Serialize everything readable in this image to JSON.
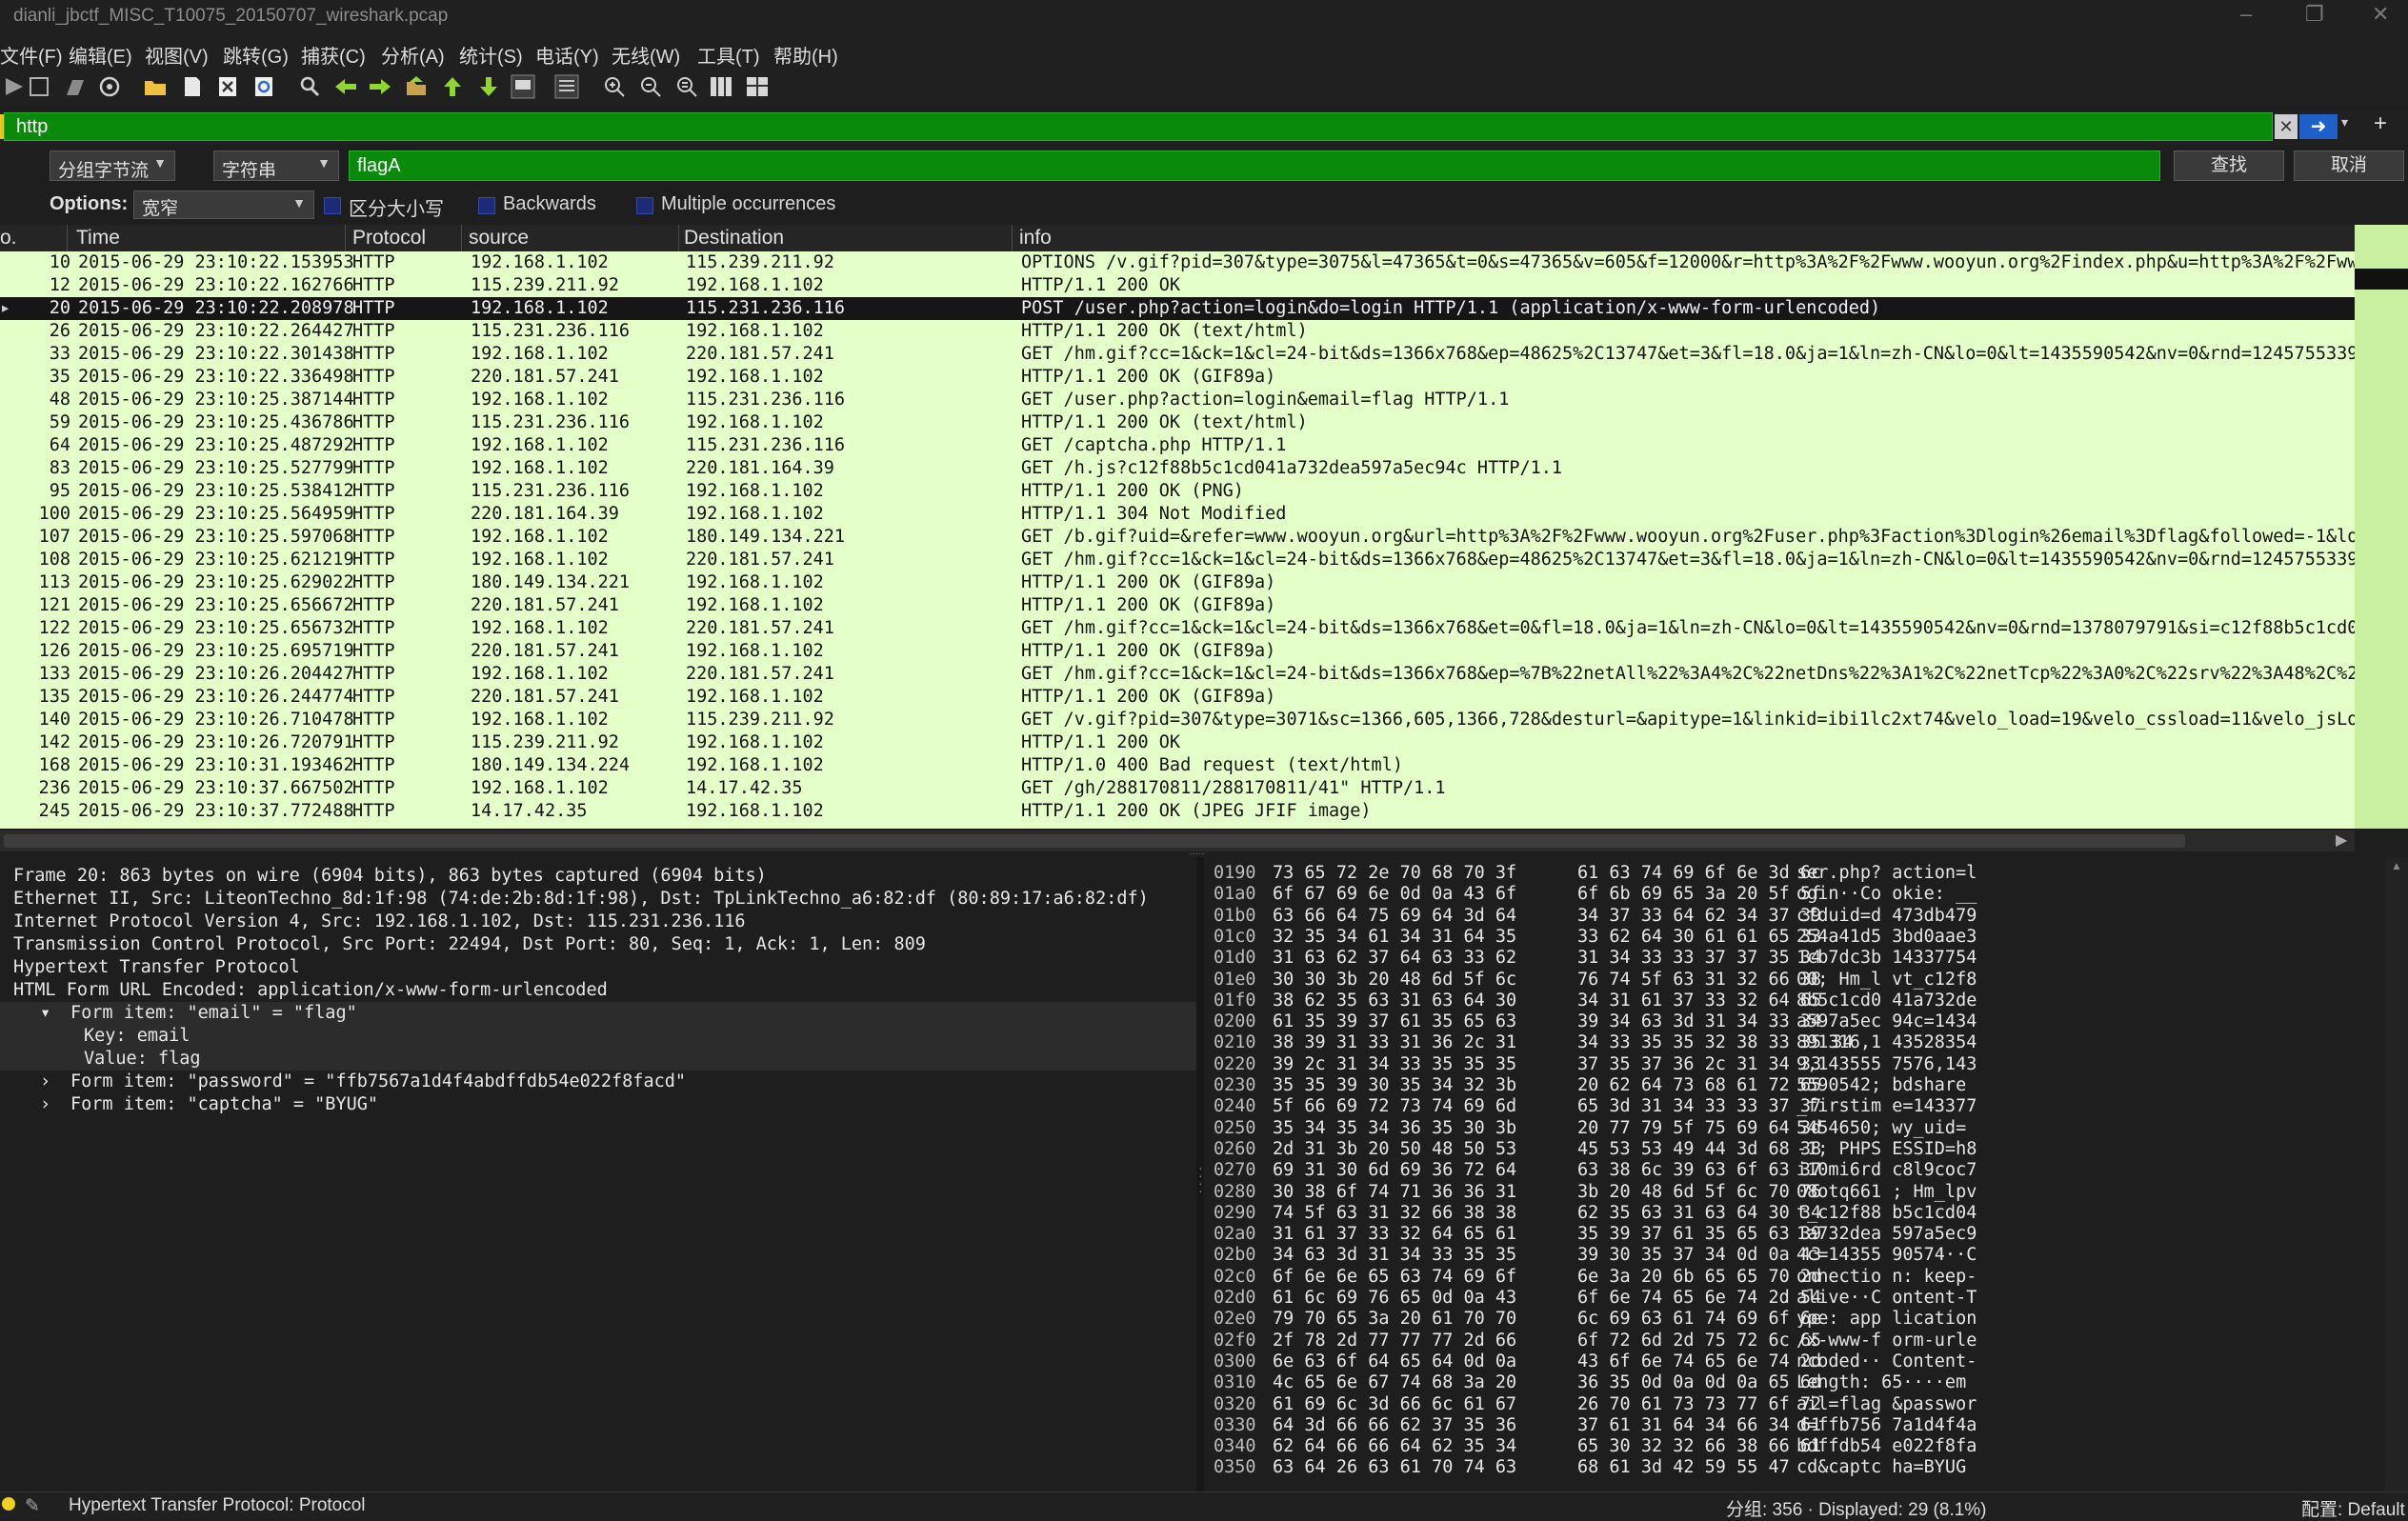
{
  "window": {
    "title": "dianli_jbctf_MISC_T10075_20150707_wireshark.pcap"
  },
  "menu": [
    "文件(F)",
    "编辑(E)",
    "视图(V)",
    "跳转(G)",
    "捕获(C)",
    "分析(A)",
    "统计(S)",
    "电话(Y)",
    "无线(W)",
    "工具(T)",
    "帮助(H)"
  ],
  "toolbar": {
    "icons": [
      "start-capture-icon",
      "stop-capture-icon",
      "restart-capture-icon",
      "capture-options-icon",
      "open-file-icon",
      "save-file-icon",
      "close-file-icon",
      "reload-file-icon",
      "find-packet-icon",
      "go-back-icon",
      "go-forward-icon",
      "go-to-packet-icon",
      "first-packet-icon",
      "last-packet-icon",
      "auto-scroll-icon",
      "colorize-icon",
      "zoom-in-icon",
      "zoom-out-icon",
      "normal-size-icon",
      "resize-columns-icon",
      "layout-icon"
    ]
  },
  "filter": {
    "value": "http"
  },
  "find": {
    "search_in": "分组字节流",
    "search_type": "字符串",
    "value": "flagA",
    "find_label": "查找",
    "cancel_label": "取消"
  },
  "options": {
    "label": "Options:",
    "width_value": "宽窄",
    "case_label": "区分大小写",
    "backwards_label": "Backwards",
    "multiple_label": "Multiple occurrences"
  },
  "columns": {
    "no": "o.",
    "time": "Time",
    "protocol": "Protocol",
    "source": "source",
    "destination": "Destination",
    "info": "info"
  },
  "packets": [
    {
      "no": "10",
      "time": "2015-06-29 23:10:22.153953",
      "proto": "HTTP",
      "src": "192.168.1.102",
      "dst": "115.239.211.92",
      "info": "OPTIONS /v.gif?pid=307&type=3075&l=47365&t=0&s=47365&v=605&f=12000&r=http%3A%2F%2Fwww.wooyun.org%2Findex.php&u=http%3A%2F%2Fwww.woo"
    },
    {
      "no": "12",
      "time": "2015-06-29 23:10:22.162766",
      "proto": "HTTP",
      "src": "115.239.211.92",
      "dst": "192.168.1.102",
      "info": "HTTP/1.1 200 OK"
    },
    {
      "no": "20",
      "time": "2015-06-29 23:10:22.208978",
      "proto": "HTTP",
      "src": "192.168.1.102",
      "dst": "115.231.236.116",
      "info": "POST /user.php?action=login&do=login HTTP/1.1  (application/x-www-form-urlencoded)",
      "selected": true
    },
    {
      "no": "26",
      "time": "2015-06-29 23:10:22.264427",
      "proto": "HTTP",
      "src": "115.231.236.116",
      "dst": "192.168.1.102",
      "info": "HTTP/1.1 200 OK  (text/html)"
    },
    {
      "no": "33",
      "time": "2015-06-29 23:10:22.301438",
      "proto": "HTTP",
      "src": "192.168.1.102",
      "dst": "220.181.57.241",
      "info": "GET /hm.gif?cc=1&ck=1&cl=24-bit&ds=1366x768&ep=48625%2C13747&et=3&fl=18.0&ja=1&ln=zh-CN&lo=0&lt=1435590542&nv=0&rnd=1245755339&si=c"
    },
    {
      "no": "35",
      "time": "2015-06-29 23:10:22.336498",
      "proto": "HTTP",
      "src": "220.181.57.241",
      "dst": "192.168.1.102",
      "info": "HTTP/1.1 200 OK  (GIF89a)"
    },
    {
      "no": "48",
      "time": "2015-06-29 23:10:25.387144",
      "proto": "HTTP",
      "src": "192.168.1.102",
      "dst": "115.231.236.116",
      "info": "GET /user.php?action=login&email=flag HTTP/1.1"
    },
    {
      "no": "59",
      "time": "2015-06-29 23:10:25.436786",
      "proto": "HTTP",
      "src": "115.231.236.116",
      "dst": "192.168.1.102",
      "info": "HTTP/1.1 200 OK  (text/html)"
    },
    {
      "no": "64",
      "time": "2015-06-29 23:10:25.487292",
      "proto": "HTTP",
      "src": "192.168.1.102",
      "dst": "115.231.236.116",
      "info": "GET /captcha.php HTTP/1.1"
    },
    {
      "no": "83",
      "time": "2015-06-29 23:10:25.527799",
      "proto": "HTTP",
      "src": "192.168.1.102",
      "dst": "220.181.164.39",
      "info": "GET /h.js?c12f88b5c1cd041a732dea597a5ec94c HTTP/1.1"
    },
    {
      "no": "95",
      "time": "2015-06-29 23:10:25.538412",
      "proto": "HTTP",
      "src": "115.231.236.116",
      "dst": "192.168.1.102",
      "info": "HTTP/1.1 200 OK  (PNG)"
    },
    {
      "no": "100",
      "time": "2015-06-29 23:10:25.564959",
      "proto": "HTTP",
      "src": "220.181.164.39",
      "dst": "192.168.1.102",
      "info": "HTTP/1.1 304 Not Modified"
    },
    {
      "no": "107",
      "time": "2015-06-29 23:10:25.597068",
      "proto": "HTTP",
      "src": "192.168.1.102",
      "dst": "180.149.134.221",
      "info": "GET /b.gif?uid=&refer=www.wooyun.org&url=http%3A%2F%2Fwww.wooyun.org%2Fuser.php%3Faction%3Dlogin%26email%3Dflag&followed=-1&login=0"
    },
    {
      "no": "108",
      "time": "2015-06-29 23:10:25.621219",
      "proto": "HTTP",
      "src": "192.168.1.102",
      "dst": "220.181.57.241",
      "info": "GET /hm.gif?cc=1&ck=1&cl=24-bit&ds=1366x768&ep=48625%2C13747&et=3&fl=18.0&ja=1&ln=zh-CN&lo=0&lt=1435590542&nv=0&rnd=1245755339&si=c"
    },
    {
      "no": "113",
      "time": "2015-06-29 23:10:25.629022",
      "proto": "HTTP",
      "src": "180.149.134.221",
      "dst": "192.168.1.102",
      "info": "HTTP/1.1 200 OK  (GIF89a)"
    },
    {
      "no": "121",
      "time": "2015-06-29 23:10:25.656672",
      "proto": "HTTP",
      "src": "220.181.57.241",
      "dst": "192.168.1.102",
      "info": "HTTP/1.1 200 OK  (GIF89a)"
    },
    {
      "no": "122",
      "time": "2015-06-29 23:10:25.656732",
      "proto": "HTTP",
      "src": "192.168.1.102",
      "dst": "220.181.57.241",
      "info": "GET /hm.gif?cc=1&ck=1&cl=24-bit&ds=1366x768&et=0&fl=18.0&ja=1&ln=zh-CN&lo=0&lt=1435590542&nv=0&rnd=1378079791&si=c12f88b5c1cd041a73"
    },
    {
      "no": "126",
      "time": "2015-06-29 23:10:25.695719",
      "proto": "HTTP",
      "src": "220.181.57.241",
      "dst": "192.168.1.102",
      "info": "HTTP/1.1 200 OK  (GIF89a)"
    },
    {
      "no": "133",
      "time": "2015-06-29 23:10:26.204427",
      "proto": "HTTP",
      "src": "192.168.1.102",
      "dst": "220.181.57.241",
      "info": "GET /hm.gif?cc=1&ck=1&cl=24-bit&ds=1366x768&ep=%7B%22netAll%22%3A4%2C%22netDns%22%3A1%2C%22netTcp%22%3A0%2C%22srv%22%3A48%2C%22dom%"
    },
    {
      "no": "135",
      "time": "2015-06-29 23:10:26.244774",
      "proto": "HTTP",
      "src": "220.181.57.241",
      "dst": "192.168.1.102",
      "info": "HTTP/1.1 200 OK  (GIF89a)"
    },
    {
      "no": "140",
      "time": "2015-06-29 23:10:26.710478",
      "proto": "HTTP",
      "src": "192.168.1.102",
      "dst": "115.239.211.92",
      "info": "GET /v.gif?pid=307&type=3071&sc=1366,605,1366,728&desturl=&apitype=1&linkid=ibi1lc2xt74&velo_load=19&velo_cssload=11&velo_jsLoad=13"
    },
    {
      "no": "142",
      "time": "2015-06-29 23:10:26.720791",
      "proto": "HTTP",
      "src": "115.239.211.92",
      "dst": "192.168.1.102",
      "info": "HTTP/1.1 200 OK"
    },
    {
      "no": "168",
      "time": "2015-06-29 23:10:31.193462",
      "proto": "HTTP",
      "src": "180.149.134.224",
      "dst": "192.168.1.102",
      "info": "HTTP/1.0 400 Bad request  (text/html)"
    },
    {
      "no": "236",
      "time": "2015-06-29 23:10:37.667502",
      "proto": "HTTP",
      "src": "192.168.1.102",
      "dst": "14.17.42.35",
      "info": "GET /gh/288170811/288170811/41\" HTTP/1.1"
    },
    {
      "no": "245",
      "time": "2015-06-29 23:10:37.772488",
      "proto": "HTTP",
      "src": "14.17.42.35",
      "dst": "192.168.1.102",
      "info": "HTTP/1.1 200 OK  (JPEG JFIF image)"
    }
  ],
  "details": [
    {
      "text": "Frame 20: 863 bytes on wire (6904 bits), 863 bytes captured (6904 bits)",
      "indent": 0,
      "toggle": ""
    },
    {
      "text": "Ethernet II, Src: LiteonTechno_8d:1f:98 (74:de:2b:8d:1f:98), Dst: TpLinkTechno_a6:82:df (80:89:17:a6:82:df)",
      "indent": 0,
      "toggle": ""
    },
    {
      "text": "Internet Protocol Version 4, Src: 192.168.1.102, Dst: 115.231.236.116",
      "indent": 0,
      "toggle": ""
    },
    {
      "text": "Transmission Control Protocol, Src Port: 22494, Dst Port: 80, Seq: 1, Ack: 1, Len: 809",
      "indent": 0,
      "toggle": ""
    },
    {
      "text": "Hypertext Transfer Protocol",
      "indent": 0,
      "toggle": ""
    },
    {
      "text": "HTML Form URL Encoded: application/x-www-form-urlencoded",
      "indent": 0,
      "toggle": ""
    },
    {
      "text": "Form item: \"email\" = \"flag\"",
      "indent": 1,
      "toggle": "▾",
      "hl": true
    },
    {
      "text": "Key: email",
      "indent": 2,
      "toggle": "",
      "hl": true
    },
    {
      "text": "Value: flag",
      "indent": 2,
      "toggle": "",
      "hl": true
    },
    {
      "text": "Form item: \"password\" = \"ffb7567a1d4f4abdffdb54e022f8facd\"",
      "indent": 1,
      "toggle": "›"
    },
    {
      "text": "Form item: \"captcha\" = \"BYUG\"",
      "indent": 1,
      "toggle": "›"
    }
  ],
  "hex": [
    {
      "off": "0190",
      "b1": "73 65 72 2e 70 68 70 3f",
      "b2": "61 63 74 69 6f 6e 3d 6c",
      "a": "ser.php? action=l"
    },
    {
      "off": "01a0",
      "b1": "6f 67 69 6e 0d 0a 43 6f",
      "b2": "6f 6b 69 65 3a 20 5f 5f",
      "a": "ogin··Co okie: __"
    },
    {
      "off": "01b0",
      "b1": "63 66 64 75 69 64 3d 64",
      "b2": "34 37 33 64 62 34 37 39",
      "a": "cfduid=d 473db479"
    },
    {
      "off": "01c0",
      "b1": "32 35 34 61 34 31 64 35",
      "b2": "33 62 64 30 61 61 65 33",
      "a": "254a41d5 3bd0aae3"
    },
    {
      "off": "01d0",
      "b1": "31 63 62 37 64 63 33 62",
      "b2": "31 34 33 33 37 37 35 34",
      "a": "1cb7dc3b 14337754"
    },
    {
      "off": "01e0",
      "b1": "30 30 3b 20 48 6d 5f 6c",
      "b2": "76 74 5f 63 31 32 66 38",
      "a": "00; Hm_l vt_c12f8"
    },
    {
      "off": "01f0",
      "b1": "38 62 35 63 31 63 64 30",
      "b2": "34 31 61 37 33 32 64 65",
      "a": "8b5c1cd0 41a732de"
    },
    {
      "off": "0200",
      "b1": "61 35 39 37 61 35 65 63",
      "b2": "39 34 63 3d 31 34 33 34",
      "a": "a597a5ec 94c=1434"
    },
    {
      "off": "0210",
      "b1": "38 39 31 33 31 36 2c 31",
      "b2": "34 33 35 35 32 38 33 35 34",
      "a": "891316,1 43528354"
    },
    {
      "off": "0220",
      "b1": "39 2c 31 34 33 35 35 35",
      "b2": "37 35 37 36 2c 31 34 33",
      "a": "9,143555 7576,143"
    },
    {
      "off": "0230",
      "b1": "35 35 39 30 35 34 32 3b",
      "b2": "20 62 64 73 68 61 72 65",
      "a": "5590542;  bdshare"
    },
    {
      "off": "0240",
      "b1": "5f 66 69 72 73 74 69 6d",
      "b2": "65 3d 31 34 33 33 37 37",
      "a": "_firstim e=143377"
    },
    {
      "off": "0250",
      "b1": "35 34 35 34 36 35 30 3b",
      "b2": "20 77 79 5f 75 69 64 3d",
      "a": "5454650;  wy_uid="
    },
    {
      "off": "0260",
      "b1": "2d 31 3b 20 50 48 50 53",
      "b2": "45 53 53 49 44 3d 68 38",
      "a": "-1; PHPS ESSID=h8"
    },
    {
      "off": "0270",
      "b1": "69 31 30 6d 69 36 72 64",
      "b2": "63 38 6c 39 63 6f 63 37",
      "a": "i10mi6rd c8l9coc7"
    },
    {
      "off": "0280",
      "b1": "30 38 6f 74 71 36 36 31",
      "b2": "3b 20 48 6d 5f 6c 70 76",
      "a": "08otq661 ; Hm_lpv"
    },
    {
      "off": "0290",
      "b1": "74 5f 63 31 32 66 38 38",
      "b2": "62 35 63 31 63 64 30 34",
      "a": "t_c12f88 b5c1cd04"
    },
    {
      "off": "02a0",
      "b1": "31 61 37 33 32 64 65 61",
      "b2": "35 39 37 61 35 65 63 39",
      "a": "1a732dea 597a5ec9"
    },
    {
      "off": "02b0",
      "b1": "34 63 3d 31 34 33 35 35",
      "b2": "39 30 35 37 34 0d 0a 43",
      "a": "4c=14355 90574··C"
    },
    {
      "off": "02c0",
      "b1": "6f 6e 6e 65 63 74 69 6f",
      "b2": "6e 3a 20 6b 65 65 70 2d",
      "a": "onnectio n: keep-"
    },
    {
      "off": "02d0",
      "b1": "61 6c 69 76 65 0d 0a 43",
      "b2": "6f 6e 74 65 6e 74 2d 54",
      "a": "alive··C ontent-T"
    },
    {
      "off": "02e0",
      "b1": "79 70 65 3a 20 61 70 70",
      "b2": "6c 69 63 61 74 69 6f 6e",
      "a": "ype: app lication"
    },
    {
      "off": "02f0",
      "b1": "2f 78 2d 77 77 77 2d 66",
      "b2": "6f 72 6d 2d 75 72 6c 65",
      "a": "/x-www-f orm-urle"
    },
    {
      "off": "0300",
      "b1": "6e 63 6f 64 65 64 0d 0a",
      "b2": "43 6f 6e 74 65 6e 74 2d",
      "a": "ncoded·· Content-"
    },
    {
      "off": "0310",
      "b1": "4c 65 6e 67 74 68 3a 20",
      "b2": "36 35 0d 0a 0d 0a 65 6d",
      "a": "Length:  65····em"
    },
    {
      "off": "0320",
      "b1": "61 69 6c 3d 66 6c 61 67",
      "b2": "26 70 61 73 73 77 6f 72",
      "a": "ail=flag &passwor"
    },
    {
      "off": "0330",
      "b1": "64 3d 66 66 62 37 35 36",
      "b2": "37 61 31 64 34 66 34 61",
      "a": "d=ffb756 7a1d4f4a"
    },
    {
      "off": "0340",
      "b1": "62 64 66 66 64 62 35 34",
      "b2": "65 30 32 32 66 38 66 61",
      "a": "bdffdb54 e022f8fa"
    },
    {
      "off": "0350",
      "b1": "63 64 26 63 61 70 74 63",
      "b2": "68 61 3d 42 59 55 47",
      "a": "cd&captc ha=BYUG"
    }
  ],
  "status": {
    "field": "Hypertext Transfer Protocol: Protocol",
    "counts": "分组: 356 · Displayed: 29 (8.1%)",
    "profile": "配置: Default"
  },
  "colors": {
    "row_http": "#e4ffc7",
    "filter_valid": "#0a8a0a",
    "selected": "#161616"
  }
}
